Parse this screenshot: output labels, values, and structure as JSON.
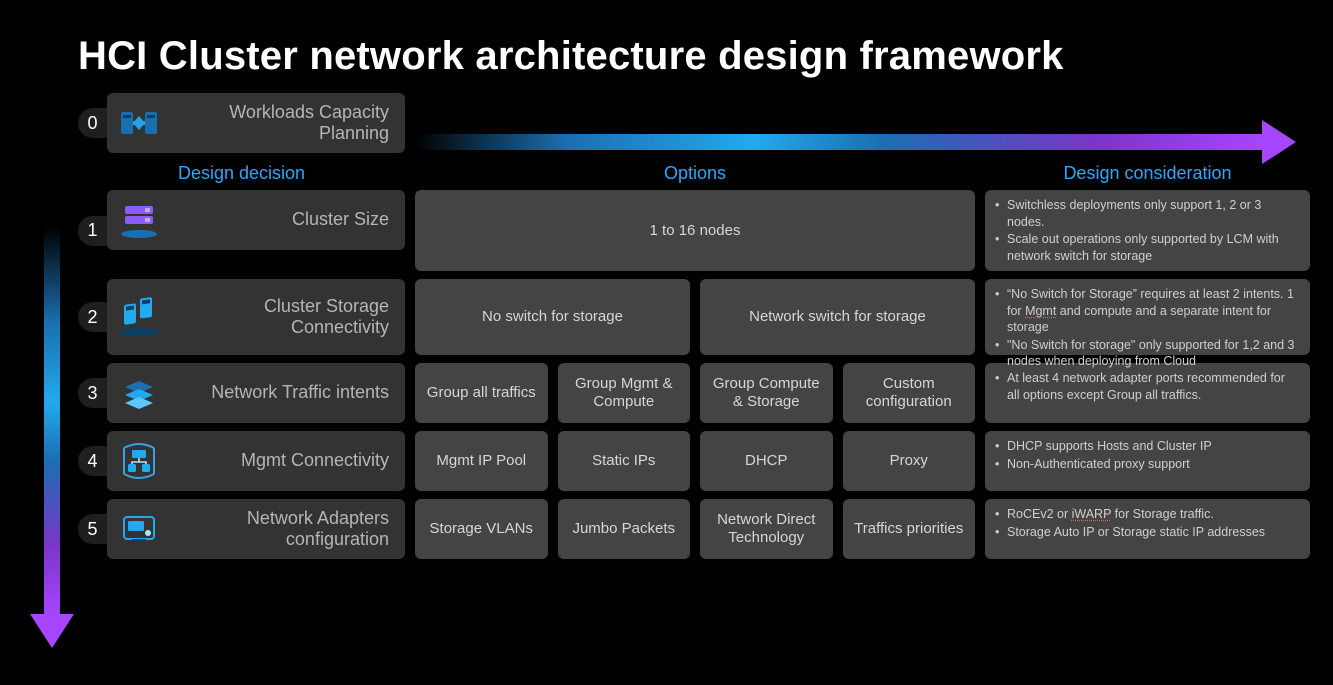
{
  "title": "HCI Cluster network architecture design framework",
  "headers": {
    "decision": "Design decision",
    "options": "Options",
    "consideration": "Design consideration"
  },
  "rows": [
    {
      "num": "0",
      "label": "Workloads Capacity Planning"
    },
    {
      "num": "1",
      "label": "Cluster Size",
      "options": [
        "1 to 16 nodes"
      ],
      "considerations": [
        "Switchless deployments only support 1, 2 or 3 nodes.",
        "Scale out operations only supported by LCM with network switch for storage"
      ]
    },
    {
      "num": "2",
      "label": "Cluster Storage Connectivity",
      "options": [
        "No switch for storage",
        "Network switch for storage"
      ],
      "considerations": [
        "\"No Switch for Storage\" requires at least 2 intents. 1 for Mgmt and compute and a separate intent for storage",
        "\"No Switch for storage\" only supported for 1,2 and 3 nodes when deploying from Cloud"
      ]
    },
    {
      "num": "3",
      "label": "Network Traffic intents",
      "options": [
        "Group all traffics",
        "Group Mgmt & Compute",
        "Group Compute & Storage",
        "Custom configuration"
      ],
      "considerations": [
        "At least 4 network adapter ports recommended for all options except Group all traffics."
      ]
    },
    {
      "num": "4",
      "label": "Mgmt Connectivity",
      "options": [
        "Mgmt IP Pool",
        "Static IPs",
        "DHCP",
        "Proxy"
      ],
      "considerations": [
        "DHCP supports Hosts and Cluster IP",
        "Non-Authenticated proxy support"
      ]
    },
    {
      "num": "5",
      "label": "Network Adapters configuration",
      "options": [
        "Storage VLANs",
        "Jumbo Packets",
        "Network Direct Technology",
        "Traffics priorities"
      ],
      "considerations": [
        "RoCEv2 or iWARP for Storage traffic.",
        "Storage Auto IP or Storage static IP addresses"
      ]
    }
  ]
}
